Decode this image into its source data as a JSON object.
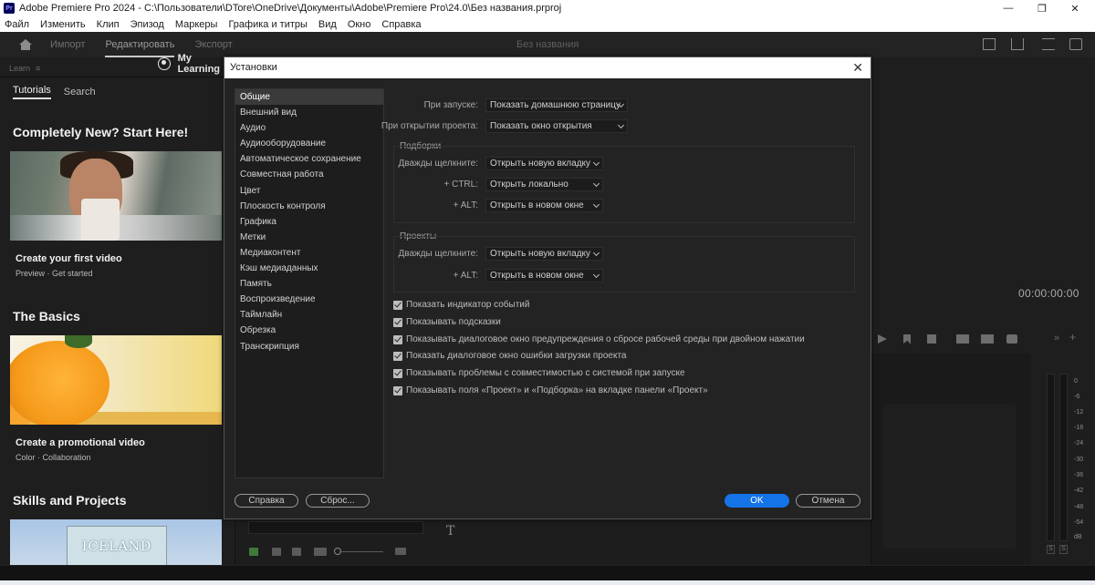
{
  "window": {
    "title": "Adobe Premiere Pro 2024 - C:\\Пользователи\\DTore\\OneDrive\\Документы\\Adobe\\Premiere Pro\\24.0\\Без названия.prproj",
    "app_icon_label": "Pr"
  },
  "menu": [
    "Файл",
    "Изменить",
    "Клип",
    "Эпизод",
    "Маркеры",
    "Графика и титры",
    "Вид",
    "Окно",
    "Справка"
  ],
  "workspace": {
    "tabs": [
      {
        "label": "Импорт",
        "active": false
      },
      {
        "label": "Редактировать",
        "active": true
      },
      {
        "label": "Экспорт",
        "active": false
      }
    ],
    "document_title": "Без названия"
  },
  "learn": {
    "panel_tab": "Learn",
    "nav_tutorials": "Tutorials",
    "nav_search": "Search",
    "my_learning": "My Learning",
    "sections": [
      {
        "heading": "Completely New? Start Here!",
        "card_title": "Create your first video",
        "meta_a": "Preview",
        "meta_b": "Get started"
      },
      {
        "heading": "The Basics",
        "card_title": "Create a promotional video",
        "meta_a": "Color",
        "meta_b": "Collaboration"
      },
      {
        "heading": "Skills and Projects",
        "thumb_text": "ICELAND"
      }
    ]
  },
  "monitor": {
    "timecode": "00:00:00:00",
    "meter_scale": [
      "0",
      "-6",
      "-12",
      "-18",
      "-24",
      "-30",
      "-36",
      "-42",
      "-48",
      "-54",
      "dB"
    ],
    "solo_label": "S"
  },
  "tools": {
    "type_tool": "T"
  },
  "dialog": {
    "title": "Установки",
    "categories": [
      "Общие",
      "Внешний вид",
      "Аудио",
      "Аудиооборудование",
      "Автоматическое сохранение",
      "Совместная работа",
      "Цвет",
      "Плоскость контроля",
      "Графика",
      "Метки",
      "Медиаконтент",
      "Кэш медиаданных",
      "Память",
      "Воспроизведение",
      "Таймлайн",
      "Обрезка",
      "Транскрипция"
    ],
    "selected_category": "Общие",
    "on_startup_label": "При запуске:",
    "on_startup_value": "Показать домашнюю страницу",
    "on_open_label": "При открытии проекта:",
    "on_open_value": "Показать окно открытия",
    "bins": {
      "heading": "Подборки",
      "double_click_label": "Дважды щелкните:",
      "double_click_value": "Открыть новую вкладку",
      "ctrl_label": "+ CTRL:",
      "ctrl_value": "Открыть локально",
      "alt_label": "+ ALT:",
      "alt_value": "Открыть в новом окне"
    },
    "projects": {
      "heading": "Проекты",
      "double_click_label": "Дважды щелкните:",
      "double_click_value": "Открыть новую вкладку",
      "alt_label": "+ ALT:",
      "alt_value": "Открыть в новом окне"
    },
    "checkboxes": [
      {
        "label": "Показать индикатор событий",
        "checked": true
      },
      {
        "label": "Показывать подсказки",
        "checked": true
      },
      {
        "label": "Показывать диалоговое окно предупреждения о сбросе рабочей среды при двойном нажатии",
        "checked": true
      },
      {
        "label": "Показать диалоговое окно ошибки загрузки проекта",
        "checked": true
      },
      {
        "label": "Показывать проблемы с совместимостью с системой при запуске",
        "checked": true
      },
      {
        "label": "Показывать поля «Проект» и «Подборка» на вкладке панели «Проект»",
        "checked": true
      }
    ],
    "help_button": "Справка",
    "reset_button": "Сброс...",
    "ok_button": "OK",
    "cancel_button": "Отмена"
  },
  "colors": {
    "accent": "#1473e6",
    "panel": "#232323",
    "background": "#1d1d1d"
  }
}
